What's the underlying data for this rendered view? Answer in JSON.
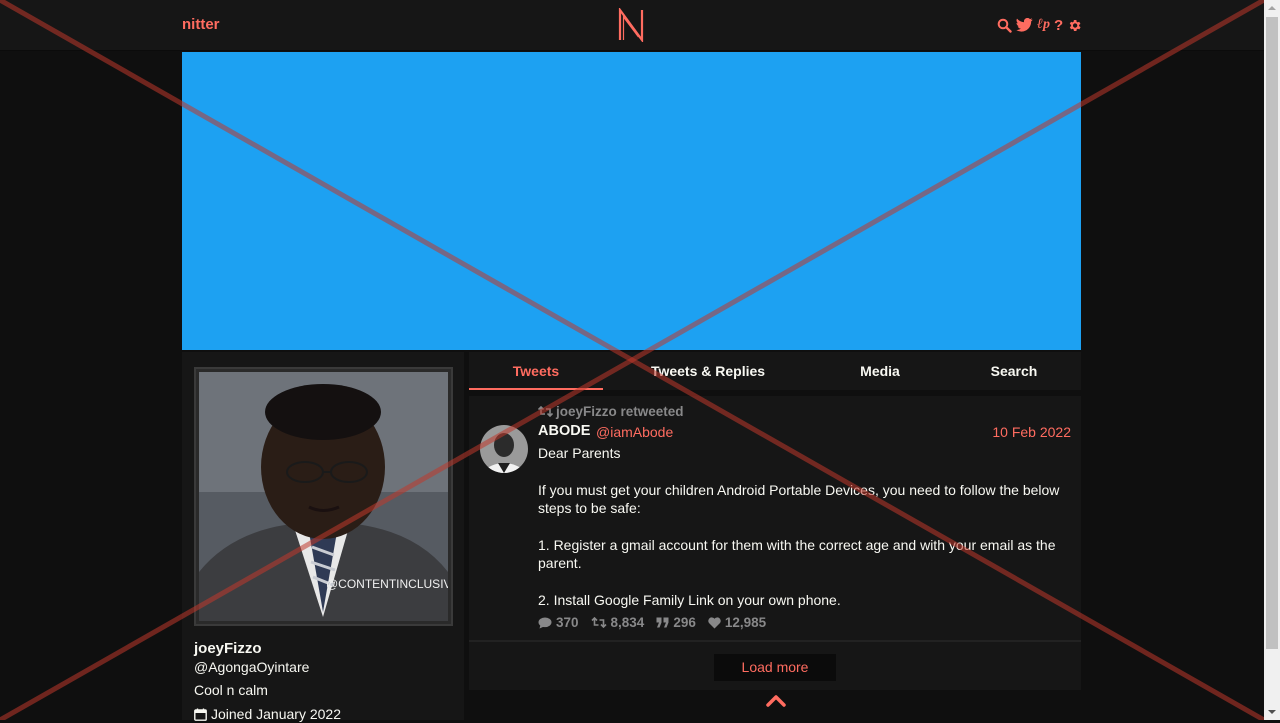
{
  "nav": {
    "brand": "nitter"
  },
  "profile": {
    "watermark": "@CONTENTINCLUSIV",
    "fullname": "joeyFizzo",
    "username": "@AgongaOyintare",
    "bio": "Cool n calm",
    "joined": "Joined January 2022"
  },
  "tabs": [
    {
      "label": "Tweets",
      "active": true
    },
    {
      "label": "Tweets & Replies",
      "active": false
    },
    {
      "label": "Media",
      "active": false
    },
    {
      "label": "Search",
      "active": false
    }
  ],
  "tweet": {
    "retweet_header": "joeyFizzo retweeted",
    "fullname": "ABODE",
    "username": "@iamAbode",
    "date": "10 Feb 2022",
    "paragraphs": [
      "Dear Parents",
      "If you must get your children Android Portable Devices, you need to follow the below steps to be safe:",
      "1. Register a gmail account for them with the correct age and with your email as the parent.",
      "2. Install Google Family Link on your own phone."
    ],
    "stats": {
      "replies": "370",
      "retweets": "8,834",
      "quotes": "296",
      "likes": "12,985"
    }
  },
  "load_more": "Load more",
  "colors": {
    "accent": "#ff6c60",
    "banner": "#1da1f2",
    "background": "#0f0f0f",
    "panel": "#161616"
  }
}
